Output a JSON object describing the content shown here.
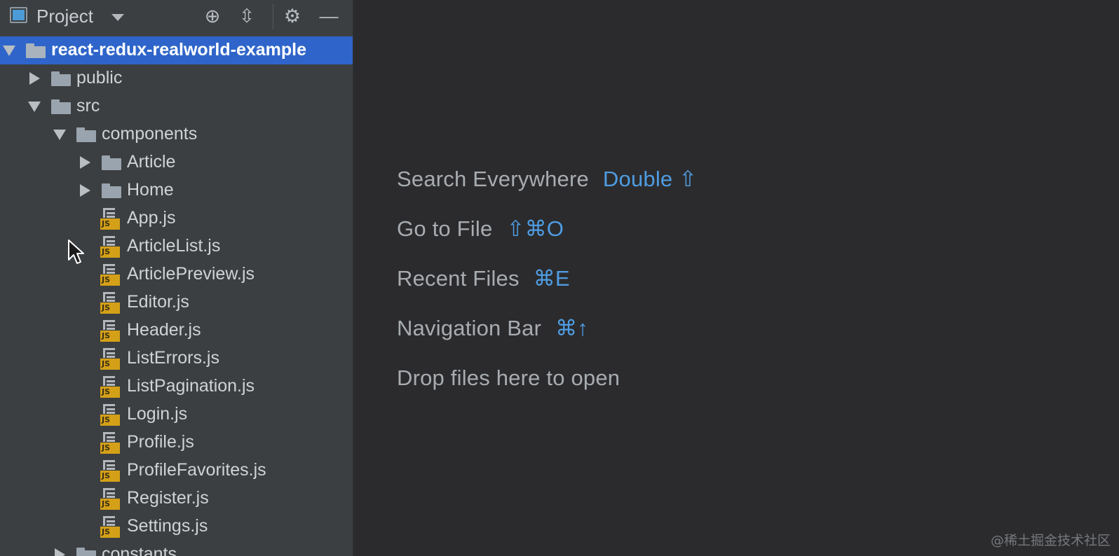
{
  "project_panel": {
    "title": "Project",
    "buttons": {
      "locate": "⊕",
      "collapse": "⇳",
      "settings": "⚙",
      "minimize": "—"
    }
  },
  "tree": [
    {
      "label": "react-redux-realworld-example",
      "kind": "folder",
      "state": "expanded",
      "depth": 0,
      "selected": true
    },
    {
      "label": "public",
      "kind": "folder",
      "state": "collapsed",
      "depth": 1
    },
    {
      "label": "src",
      "kind": "folder",
      "state": "expanded",
      "depth": 1
    },
    {
      "label": "components",
      "kind": "folder",
      "state": "expanded",
      "depth": 2
    },
    {
      "label": "Article",
      "kind": "folder",
      "state": "collapsed",
      "depth": 3
    },
    {
      "label": "Home",
      "kind": "folder",
      "state": "collapsed",
      "depth": 3
    },
    {
      "label": "App.js",
      "kind": "js",
      "depth": 3
    },
    {
      "label": "ArticleList.js",
      "kind": "js",
      "depth": 3
    },
    {
      "label": "ArticlePreview.js",
      "kind": "js",
      "depth": 3
    },
    {
      "label": "Editor.js",
      "kind": "js",
      "depth": 3
    },
    {
      "label": "Header.js",
      "kind": "js",
      "depth": 3
    },
    {
      "label": "ListErrors.js",
      "kind": "js",
      "depth": 3
    },
    {
      "label": "ListPagination.js",
      "kind": "js",
      "depth": 3
    },
    {
      "label": "Login.js",
      "kind": "js",
      "depth": 3
    },
    {
      "label": "Profile.js",
      "kind": "js",
      "depth": 3
    },
    {
      "label": "ProfileFavorites.js",
      "kind": "js",
      "depth": 3
    },
    {
      "label": "Register.js",
      "kind": "js",
      "depth": 3
    },
    {
      "label": "Settings.js",
      "kind": "js",
      "depth": 3
    },
    {
      "label": "constants",
      "kind": "folder",
      "state": "collapsed",
      "depth": 2
    }
  ],
  "js_badge": "JS",
  "editor_hints": [
    {
      "label": "Search Everywhere",
      "shortcut": "Double ⇧"
    },
    {
      "label": "Go to File",
      "shortcut": "⇧⌘O"
    },
    {
      "label": "Recent Files",
      "shortcut": "⌘E"
    },
    {
      "label": "Navigation Bar",
      "shortcut": "⌘↑"
    },
    {
      "label": "Drop files here to open",
      "shortcut": ""
    }
  ],
  "watermark": "@稀土掘金技术社区",
  "colors": {
    "sidebar_bg": "#3c3f41",
    "editor_bg": "#2b2b2d",
    "selection": "#2f65ca",
    "shortcut": "#4f9ce2",
    "js_badge": "#d4a018"
  }
}
